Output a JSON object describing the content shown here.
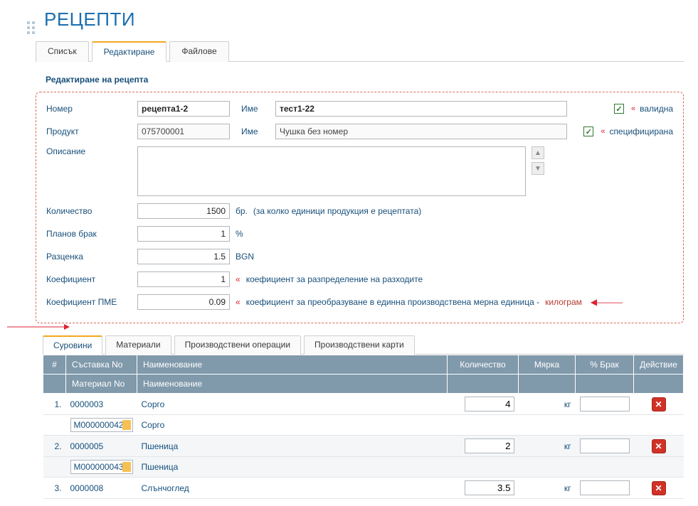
{
  "page": {
    "title": "РЕЦЕПТИ"
  },
  "tabs": {
    "list": "Списък",
    "edit": "Редактиране",
    "files": "Файлове"
  },
  "section_title": "Редактиране на рецепта",
  "form": {
    "number_label": "Номер",
    "number_value": "рецепта1-2",
    "product_label": "Продукт",
    "product_code": "075700001",
    "name_label": "Име",
    "recipe_name": "тест1-22",
    "product_name": "Чушка без номер",
    "valid_label": "валидна",
    "specified_label": "специфицирана",
    "description_label": "Описание",
    "description_value": "",
    "quantity_label": "Количество",
    "quantity_value": "1500",
    "quantity_unit": "бр.",
    "quantity_hint": "(за колко единици продукция е рецептата)",
    "scrap_label": "Планов брак",
    "scrap_value": "1",
    "scrap_unit": "%",
    "rate_label": "Разценка",
    "rate_value": "1.5",
    "rate_unit": "BGN",
    "coef_label": "Коефициент",
    "coef_value": "1",
    "coef_hint": "коефициент за разпределение на разходите",
    "pme_label": "Коефициент ПМЕ",
    "pme_value": "0.09",
    "pme_hint": "коефициент за преобразуване в единна производствена мерна единица -",
    "pme_unit": "килограм"
  },
  "subtabs": {
    "raw": "Суровини",
    "materials": "Материали",
    "ops": "Производствени операции",
    "cards": "Производствени карти"
  },
  "grid": {
    "headers": {
      "idx": "#",
      "comp_no": "Съставка No",
      "name": "Наименование",
      "material_no": "Материал No",
      "name2": "Наименование",
      "qty": "Количество",
      "unit": "Мярка",
      "scrap": "% Брак",
      "action": "Действие"
    },
    "rows": [
      {
        "idx": "1.",
        "comp_no": "0000003",
        "name": "Сорго",
        "material_no": "M000000042",
        "material_name": "Сорго",
        "qty": "4",
        "unit": "кг",
        "scrap": ""
      },
      {
        "idx": "2.",
        "comp_no": "0000005",
        "name": "Пшеница",
        "material_no": "M000000043",
        "material_name": "Пшеница",
        "qty": "2",
        "unit": "кг",
        "scrap": ""
      },
      {
        "idx": "3.",
        "comp_no": "0000008",
        "name": "Слънчоглед",
        "material_no": "",
        "material_name": "",
        "qty": "3.5",
        "unit": "кг",
        "scrap": ""
      }
    ]
  },
  "chev": "«"
}
